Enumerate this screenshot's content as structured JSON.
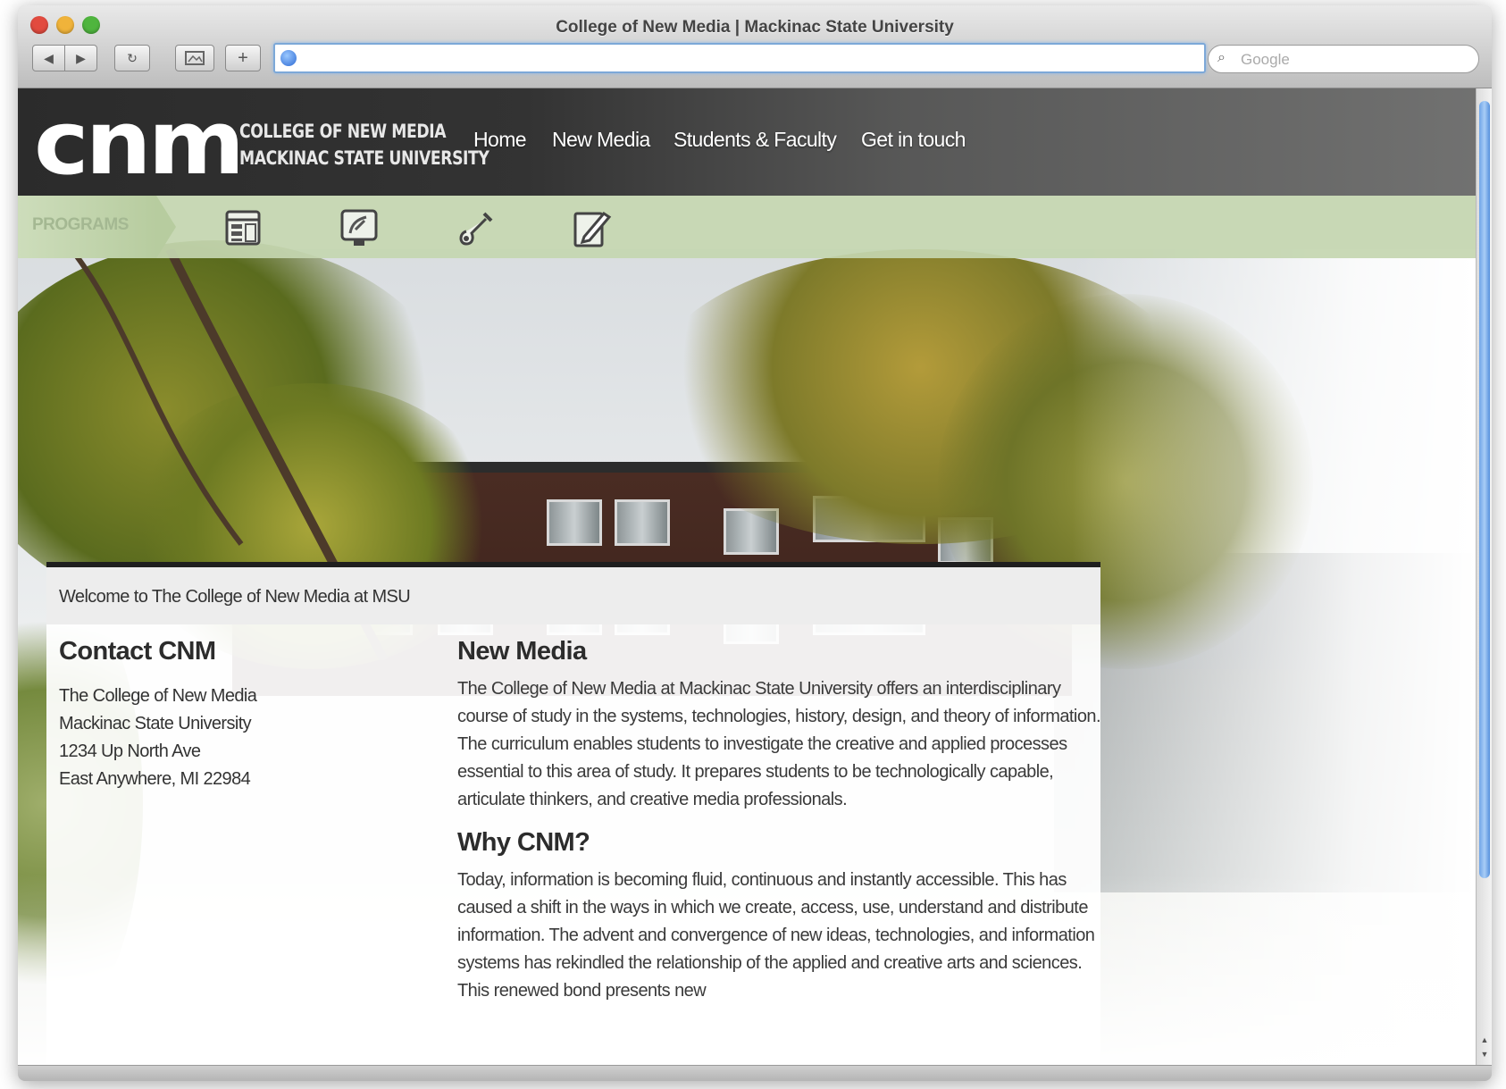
{
  "browser": {
    "title": "College of New Media | Mackinac State University",
    "address_value": "",
    "search_placeholder": "Google",
    "buttons": {
      "back": "◀",
      "forward": "▶",
      "reload": "↻",
      "add_bookmark": "+"
    }
  },
  "header": {
    "logo_mark": "cnm",
    "logo_line1": "COLLEGE OF NEW MEDIA",
    "logo_line2": "MACKINAC STATE UNIVERSITY",
    "nav": [
      {
        "label": "Home"
      },
      {
        "label": "New Media"
      },
      {
        "label": "Students & Faculty"
      },
      {
        "label": "Get in touch"
      }
    ]
  },
  "programs": {
    "label": "PROGRAMS",
    "icons": [
      "layout-grid-icon",
      "monitor-design-icon",
      "guitar-icon",
      "pencil-notepad-icon"
    ]
  },
  "content": {
    "welcome": "Welcome to The College of New Media at MSU",
    "contact": {
      "title": "Contact CNM",
      "address": [
        "The College of New Media",
        "Mackinac State University",
        "1234 Up North Ave",
        "East Anywhere, MI 22984"
      ]
    },
    "sections": [
      {
        "title": "New Media",
        "body": "The College of New Media at Mackinac State University offers an interdisciplinary course of study in the systems, technologies, history, design, and theory of information. The curriculum enables students to investigate the creative and applied processes essential to this area of study. It prepares students to be technologically capable, articulate thinkers, and creative media professionals."
      },
      {
        "title": "Why CNM?",
        "body": "Today, information is becoming fluid, continuous and instantly accessible. This has caused a shift in the ways in which we create, access, use, understand and distribute information. The advent and convergence of new ideas, technologies, and information systems has rekindled the relationship of the applied and creative arts and sciences. This renewed bond presents new"
      }
    ]
  },
  "colors": {
    "header_bg": "#2b2b2b",
    "programs_bar": "#c4d6b0",
    "scroll_thumb": "#6fa5e8"
  }
}
